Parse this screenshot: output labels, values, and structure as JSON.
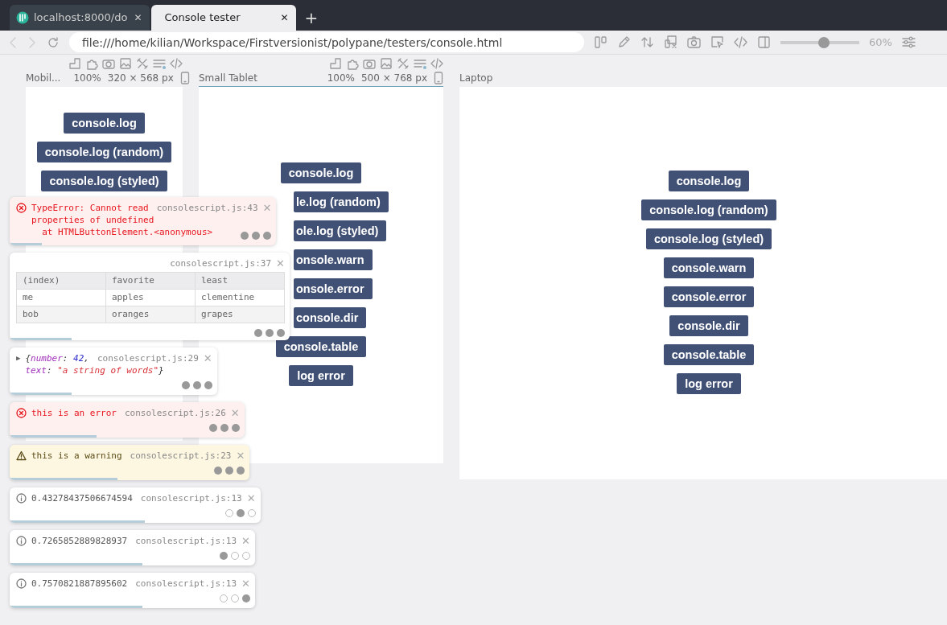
{
  "tabs": [
    {
      "label": "localhost:8000/do",
      "selected": false,
      "kind": "site",
      "close": "✕"
    },
    {
      "label": "Console tester",
      "selected": true,
      "kind": "local",
      "close": "✕"
    }
  ],
  "new_tab": "+",
  "address": {
    "value": "file:///home/kilian/Workspace/Firstversionist/polypane/testers/console.html"
  },
  "zoom": {
    "level": 0.55,
    "reading": "60%"
  },
  "panes": [
    {
      "label": "Mobil...",
      "zoom": "100%",
      "size": "320 × 568",
      "unit": "px",
      "selected": false,
      "tools": true,
      "buttons": [
        {
          "label": "console.log",
          "kind": "full"
        },
        {
          "label": "console.log (random)",
          "kind": "full"
        },
        {
          "label": "console.log (styled)",
          "kind": "full"
        }
      ]
    },
    {
      "label": "Small Tablet",
      "zoom": "100%",
      "size": "500 × 768",
      "unit": "px",
      "selected": true,
      "tools": true,
      "buttons": [
        {
          "label": "console.log",
          "kind": "full"
        },
        {
          "label": "le.log (random)",
          "kind": "partial"
        },
        {
          "label": "ole.log (styled)",
          "kind": "partial"
        },
        {
          "label": "onsole.warn",
          "kind": "partial"
        },
        {
          "label": "onsole.error",
          "kind": "partial"
        },
        {
          "label": "console.dir",
          "kind": "partial"
        },
        {
          "label": "console.table",
          "kind": "full"
        },
        {
          "label": "log error",
          "kind": "full"
        }
      ]
    },
    {
      "label": "Laptop",
      "selected": false,
      "tools": false,
      "buttons": [
        {
          "label": "console.log",
          "kind": "full"
        },
        {
          "label": "console.log (random)",
          "kind": "full"
        },
        {
          "label": "console.log (styled)",
          "kind": "full"
        },
        {
          "label": "console.warn",
          "kind": "full"
        },
        {
          "label": "console.error",
          "kind": "full"
        },
        {
          "label": "console.dir",
          "kind": "full"
        },
        {
          "label": "console.table",
          "kind": "full"
        },
        {
          "label": "log error",
          "kind": "full"
        }
      ]
    }
  ],
  "toasts": [
    {
      "kind": "error",
      "lines": [
        "TypeError: Cannot read",
        "properties of undefined",
        "  at HTMLButtonElement.<anonymous>"
      ],
      "source": "consolescript.js:43",
      "close": "✕",
      "level": 0.12,
      "dots": [
        true,
        true,
        true
      ]
    },
    {
      "kind": "table",
      "source": "consolescript.js:37",
      "close": "✕",
      "level": 0.22,
      "dots": [
        true,
        true,
        true
      ],
      "columns": [
        "(index)",
        "favorite",
        "least"
      ],
      "rows": [
        [
          "me",
          "apples",
          "clementine"
        ],
        [
          "bob",
          "oranges",
          "grapes"
        ]
      ]
    },
    {
      "kind": "object",
      "toggle": "▶",
      "tokens": [
        [
          {
            "kind": "punct",
            "text": "{"
          },
          {
            "kind": "key",
            "text": "number"
          },
          {
            "kind": "punct",
            "text": ": "
          },
          {
            "kind": "number",
            "text": "42"
          },
          {
            "kind": "punct",
            "text": ","
          }
        ],
        [
          {
            "kind": "key",
            "text": "text"
          },
          {
            "kind": "punct",
            "text": ": "
          },
          {
            "kind": "string",
            "text": "\"a string of words\""
          },
          {
            "kind": "punct",
            "text": "}"
          }
        ]
      ],
      "source": "consolescript.js:29",
      "close": "✕",
      "level": 0.3,
      "dots": [
        true,
        true,
        true
      ]
    },
    {
      "kind": "error",
      "lines": [
        "this is an error"
      ],
      "source": "consolescript.js:26",
      "close": "✕",
      "level": 0.37,
      "dots": [
        true,
        true,
        true
      ]
    },
    {
      "kind": "warning",
      "lines": [
        "this is a warning"
      ],
      "source": "consolescript.js:23",
      "close": "✕",
      "level": 0.45,
      "dots": [
        true,
        true,
        true
      ]
    },
    {
      "kind": "info",
      "lines": [
        "0.43278437506674594"
      ],
      "source": "consolescript.js:13",
      "close": "✕",
      "level": 0.54,
      "dots": [
        false,
        true,
        false
      ]
    },
    {
      "kind": "info",
      "lines": [
        "0.7265852889828937"
      ],
      "source": "consolescript.js:13",
      "close": "✕",
      "level": 0.54,
      "dots": [
        true,
        false,
        false
      ]
    },
    {
      "kind": "info",
      "lines": [
        "0.7570821887895602"
      ],
      "source": "consolescript.js:13",
      "close": "✕",
      "level": 0.54,
      "dots": [
        false,
        false,
        true
      ]
    }
  ]
}
